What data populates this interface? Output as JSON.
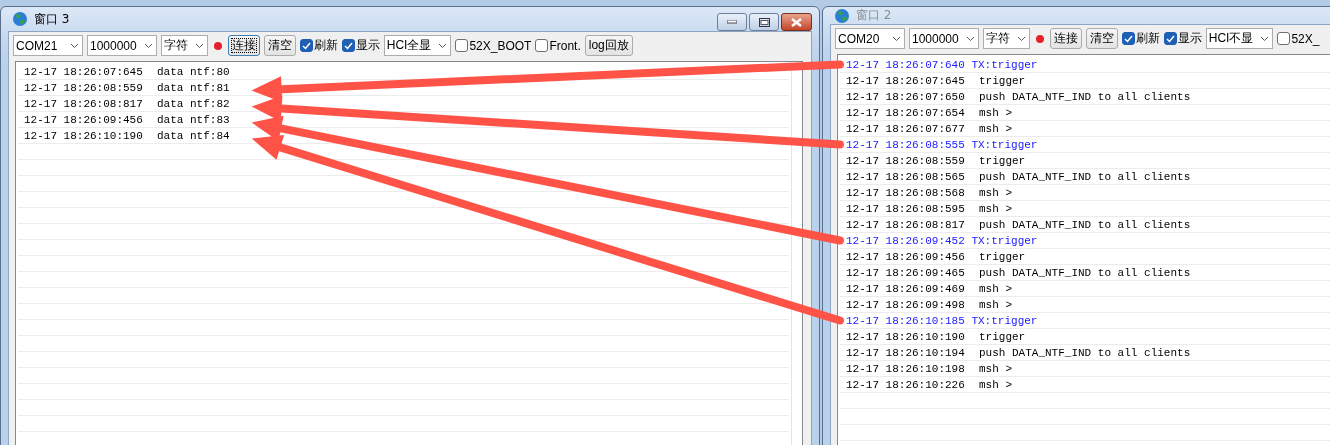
{
  "windows": [
    {
      "title": "窗口 3",
      "active": true,
      "toolbar": [
        {
          "kind": "select",
          "value": "COM21"
        },
        {
          "kind": "select",
          "value": "1000000"
        },
        {
          "kind": "select",
          "value": "字符"
        },
        {
          "kind": "indicator",
          "connected": false
        },
        {
          "kind": "button",
          "label": "连接",
          "focused": true
        },
        {
          "kind": "button",
          "label": "清空",
          "focused": false
        },
        {
          "kind": "checkbox",
          "label": "刷新",
          "checked": true
        },
        {
          "kind": "checkbox",
          "label": "显示",
          "checked": true
        },
        {
          "kind": "select",
          "value": "HCI全显"
        },
        {
          "kind": "checkbox",
          "label": "52X_BOOT",
          "checked": false
        },
        {
          "kind": "checkbox",
          "label": "Front.",
          "checked": false
        },
        {
          "kind": "button",
          "label": "log回放",
          "focused": false
        }
      ],
      "log": [
        {
          "kind": "rx",
          "time": "12-17 18:26:07:645",
          "text": "data ntf:80",
          "arrow": false
        },
        {
          "kind": "rx",
          "time": "12-17 18:26:08:559",
          "text": "data ntf:81",
          "arrow": true
        },
        {
          "kind": "rx",
          "time": "12-17 18:26:08:817",
          "text": "data ntf:82",
          "arrow": true
        },
        {
          "kind": "rx",
          "time": "12-17 18:26:09:456",
          "text": "data ntf:83",
          "arrow": true
        },
        {
          "kind": "rx",
          "time": "12-17 18:26:10:190",
          "text": "data ntf:84",
          "arrow": true
        }
      ]
    },
    {
      "title": "窗口 2",
      "active": false,
      "toolbar": [
        {
          "kind": "select",
          "value": "COM20"
        },
        {
          "kind": "select",
          "value": "1000000"
        },
        {
          "kind": "select",
          "value": "字符"
        },
        {
          "kind": "indicator",
          "connected": false
        },
        {
          "kind": "button",
          "label": "连接",
          "focused": false
        },
        {
          "kind": "button",
          "label": "清空",
          "focused": false
        },
        {
          "kind": "checkbox",
          "label": "刷新",
          "checked": true
        },
        {
          "kind": "checkbox",
          "label": "显示",
          "checked": true
        },
        {
          "kind": "select",
          "value": "HCI不显"
        },
        {
          "kind": "checkbox",
          "label": "52X_",
          "checked": false
        }
      ],
      "log": [
        {
          "kind": "tx",
          "text": "12-17 18:26:07:640 TX:trigger"
        },
        {
          "kind": "rx",
          "time": "12-17 18:26:07:645",
          "text": "trigger"
        },
        {
          "kind": "rx",
          "time": "12-17 18:26:07:650",
          "text": "push DATA_NTF_IND to all clients"
        },
        {
          "kind": "rx",
          "time": "12-17 18:26:07:654",
          "text": "msh >"
        },
        {
          "kind": "rx",
          "time": "12-17 18:26:07:677",
          "text": "msh >"
        },
        {
          "kind": "tx",
          "text": "12-17 18:26:08:555 TX:trigger"
        },
        {
          "kind": "rx",
          "time": "12-17 18:26:08:559",
          "text": "trigger"
        },
        {
          "kind": "rx",
          "time": "12-17 18:26:08:565",
          "text": "push DATA_NTF_IND to all clients"
        },
        {
          "kind": "rx",
          "time": "12-17 18:26:08:568",
          "text": "msh >"
        },
        {
          "kind": "rx",
          "time": "12-17 18:26:08:595",
          "text": "msh >"
        },
        {
          "kind": "rx",
          "time": "12-17 18:26:08:817",
          "text": "push DATA_NTF_IND to all clients"
        },
        {
          "kind": "tx",
          "text": "12-17 18:26:09:452 TX:trigger"
        },
        {
          "kind": "rx",
          "time": "12-17 18:26:09:456",
          "text": "trigger"
        },
        {
          "kind": "rx",
          "time": "12-17 18:26:09:465",
          "text": "push DATA_NTF_IND to all clients"
        },
        {
          "kind": "rx",
          "time": "12-17 18:26:09:469",
          "text": "msh >"
        },
        {
          "kind": "rx",
          "time": "12-17 18:26:09:498",
          "text": "msh >"
        },
        {
          "kind": "tx",
          "text": "12-17 18:26:10:185 TX:trigger"
        },
        {
          "kind": "rx",
          "time": "12-17 18:26:10:190",
          "text": "trigger"
        },
        {
          "kind": "rx",
          "time": "12-17 18:26:10:194",
          "text": "push DATA_NTF_IND to all clients"
        },
        {
          "kind": "rx",
          "time": "12-17 18:26:10:198",
          "text": "msh >"
        },
        {
          "kind": "rx",
          "time": "12-17 18:26:10:226",
          "text": "msh >"
        }
      ]
    }
  ]
}
